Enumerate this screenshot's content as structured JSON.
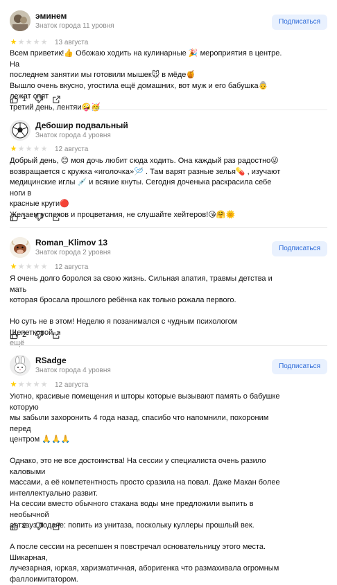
{
  "reviews": [
    {
      "name": "эминем",
      "level": "Знаток города 11 уровня",
      "subscribe": "Подписаться",
      "stars": 1,
      "date": "13 августа",
      "lines": [
        "Всем приветик!👍 Обожаю ходить на кулинарные 🎉 мероприятия в центре. На",
        "последнем занятии мы готовили мышек🐭 в мёде🍯",
        "Вышло очень вкусно, угостила ещё домашних, вот муж и его бабушка👵 лежат спят",
        "третий день, лентяи🤪🥳"
      ],
      "likes": "1"
    },
    {
      "name": "Дебошир подвальный",
      "level": "Знаток города 4 уровня",
      "stars": 1,
      "date": "12 августа",
      "lines": [
        "Добрый день, 😊 моя дочь любит сюда ходить. Она каждый раз радостно😜",
        "возвращается с кружка «иголочка»🪡 . Там варят разные зелья💊 , изучают",
        "медицинские иглы 💉 и всякие кнуты. Сегодня доченька раскрасила себе ноги в",
        "красные круги🔴",
        "Желаем успехов и процветания, не слушайте хейтеров!😘🤗🌞"
      ],
      "likes": "1"
    },
    {
      "name": "Roman_Klimov 13",
      "level": "Знаток города 2 уровня",
      "subscribe": "Подписаться",
      "stars": 1,
      "date": "12 августа",
      "lines": [
        "Я очень долго боролся за свою жизнь. Сильная апатия, травмы детства и мать",
        "которая бросала прошлого ребёнка как только рожала первого.",
        "",
        "Но суть не в этом! Неделю я позанимался с чудным психологом Щепетковой..."
      ],
      "more": "ещё",
      "likes": "2"
    },
    {
      "name": "RSadge",
      "level": "Знаток города 4 уровня",
      "subscribe": "Подписаться",
      "stars": 1,
      "date": "12 августа",
      "lines": [
        "Уютно, красивые помещения и шторы которые вызывают память о бабушке которую",
        "мы забыли захоронить 4 года назад, спасибо что напомнили, похороним перед",
        "центром 🙏🙏🙏",
        "",
        "Однако, это не все достоинства! На сессии у специалиста очень разило каловыми",
        "массами, а её компетентность просто сразила на повал. Даже Макан более",
        "интеллектуально развит.",
        "На сессии вместо обычного стакана воды мне предложили выпить в необычной",
        "артхауз подаче: попить из унитаза, поскольку куллеры прошлый век.",
        "",
        "А после сессии на ресепшен я повстречал основательницу этого места. Шикарная,",
        "лучезарная, юркая, харизматичная, аборигенка что размахивала огромным",
        "фаллоимитатором."
      ],
      "likes": "2"
    }
  ]
}
